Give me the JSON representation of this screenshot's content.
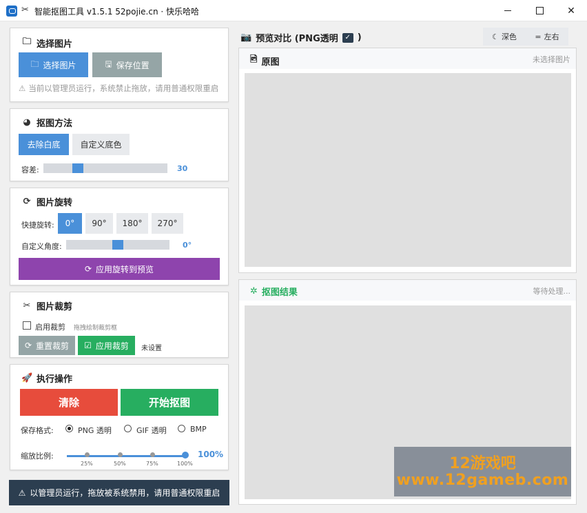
{
  "window": {
    "title": "智能抠图工具 v1.5.1 52pojie.cn · 快乐哈哈",
    "close_glyph": "✕"
  },
  "select_image": {
    "title": "选择图片",
    "select_button": "选择图片",
    "save_location_button": "保存位置",
    "hint": "当前以管理员运行，系统禁止拖放，请用普通权限重启"
  },
  "method": {
    "title": "抠图方法",
    "remove_white": "去除白底",
    "custom_bg": "自定义底色",
    "tolerance_label": "容差:",
    "tolerance_value": "30",
    "tolerance_fraction": 0.3
  },
  "rotate": {
    "title": "图片旋转",
    "quick_label": "快捷旋转:",
    "angles": [
      "0°",
      "90°",
      "180°",
      "270°"
    ],
    "selected_angle": "0°",
    "custom_label": "自定义角度:",
    "custom_value": "0°",
    "custom_fraction": 0.5,
    "apply_button": "应用旋转到预览"
  },
  "crop": {
    "title": "图片裁剪",
    "enable_label": "启用裁剪",
    "enable_checked": false,
    "drag_hint": "拖拽绘制裁剪框",
    "reset_button": "重置裁剪",
    "apply_button": "应用裁剪",
    "status": "未设置"
  },
  "execute": {
    "title": "执行操作",
    "clear_button": "清除",
    "start_button": "开始抠图",
    "format_label": "保存格式:",
    "formats": [
      "PNG 透明",
      "GIF 透明",
      "BMP"
    ],
    "selected_format": "PNG 透明",
    "zoom_label": "缩放比例:",
    "zoom_ticks": [
      "25%",
      "50%",
      "75%",
      "100%"
    ],
    "zoom_value": "100%",
    "zoom_fraction": 1.0
  },
  "status_bar": {
    "text": "以管理员运行，拖放被系统禁用，请用普通权限重启"
  },
  "preview": {
    "title": "预览对比 (PNG透明",
    "title_suffix": ")",
    "dark_button": "深色",
    "layout_button": "左右",
    "original": {
      "title": "原图",
      "status": "未选择图片"
    },
    "result": {
      "title": "抠图结果",
      "status": "等待处理..."
    }
  },
  "watermark": {
    "line1": "12游戏吧",
    "line2": "www.12gameb.com"
  },
  "colors": {
    "accent_blue": "#4a90d9",
    "purple": "#8e44ad",
    "green": "#27ae60",
    "red": "#e74c3c",
    "dark": "#2c3e50"
  }
}
